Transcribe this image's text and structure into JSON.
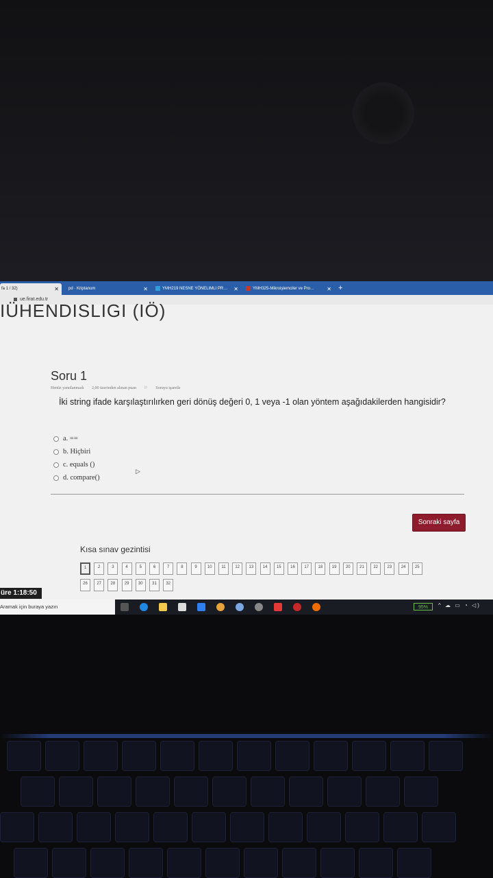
{
  "browser": {
    "tabs": [
      {
        "label": "fa 1 / 32)",
        "active": true
      },
      {
        "label": "pd · Kriptanum",
        "active": false
      },
      {
        "label": "YMH219 NESNE YÖNELIMLI PR…",
        "active": false
      },
      {
        "label": "YMH325-Mikroişlemciler ve Pro…",
        "active": false
      }
    ],
    "url": "ue.firat.edu.tr"
  },
  "page": {
    "crumb": "IÜHENDISLIGI (IÖ)",
    "question_title": "Soru 1",
    "meta": {
      "status": "Henüz yanıtlanmadı",
      "points": "2,00 üzerinden alınan puan",
      "flag": "Soruyu işaretle"
    },
    "question_text": "İki string ifade karşılaştırılırken geri dönüş değeri 0, 1 veya -1 olan yöntem aşağıdakilerden hangisidir?",
    "options": [
      "a. ==",
      "b. Hiçbiri",
      "c. equals ()",
      "d. compare()"
    ],
    "next_button": "Sonraki sayfa",
    "nav_title": "Kısa sınav gezintisi",
    "nav_numbers": [
      "1",
      "2",
      "3",
      "4",
      "5",
      "6",
      "7",
      "8",
      "9",
      "10",
      "11",
      "12",
      "13",
      "14",
      "15",
      "16",
      "17",
      "18",
      "19",
      "20",
      "21",
      "22",
      "23",
      "24",
      "25",
      "26",
      "27",
      "28",
      "29",
      "30",
      "31",
      "32"
    ],
    "current_question": "1",
    "timer": "üre 1:18:50"
  },
  "taskbar": {
    "search_placeholder": "Aramak için buraya yazın",
    "battery": "95%"
  }
}
